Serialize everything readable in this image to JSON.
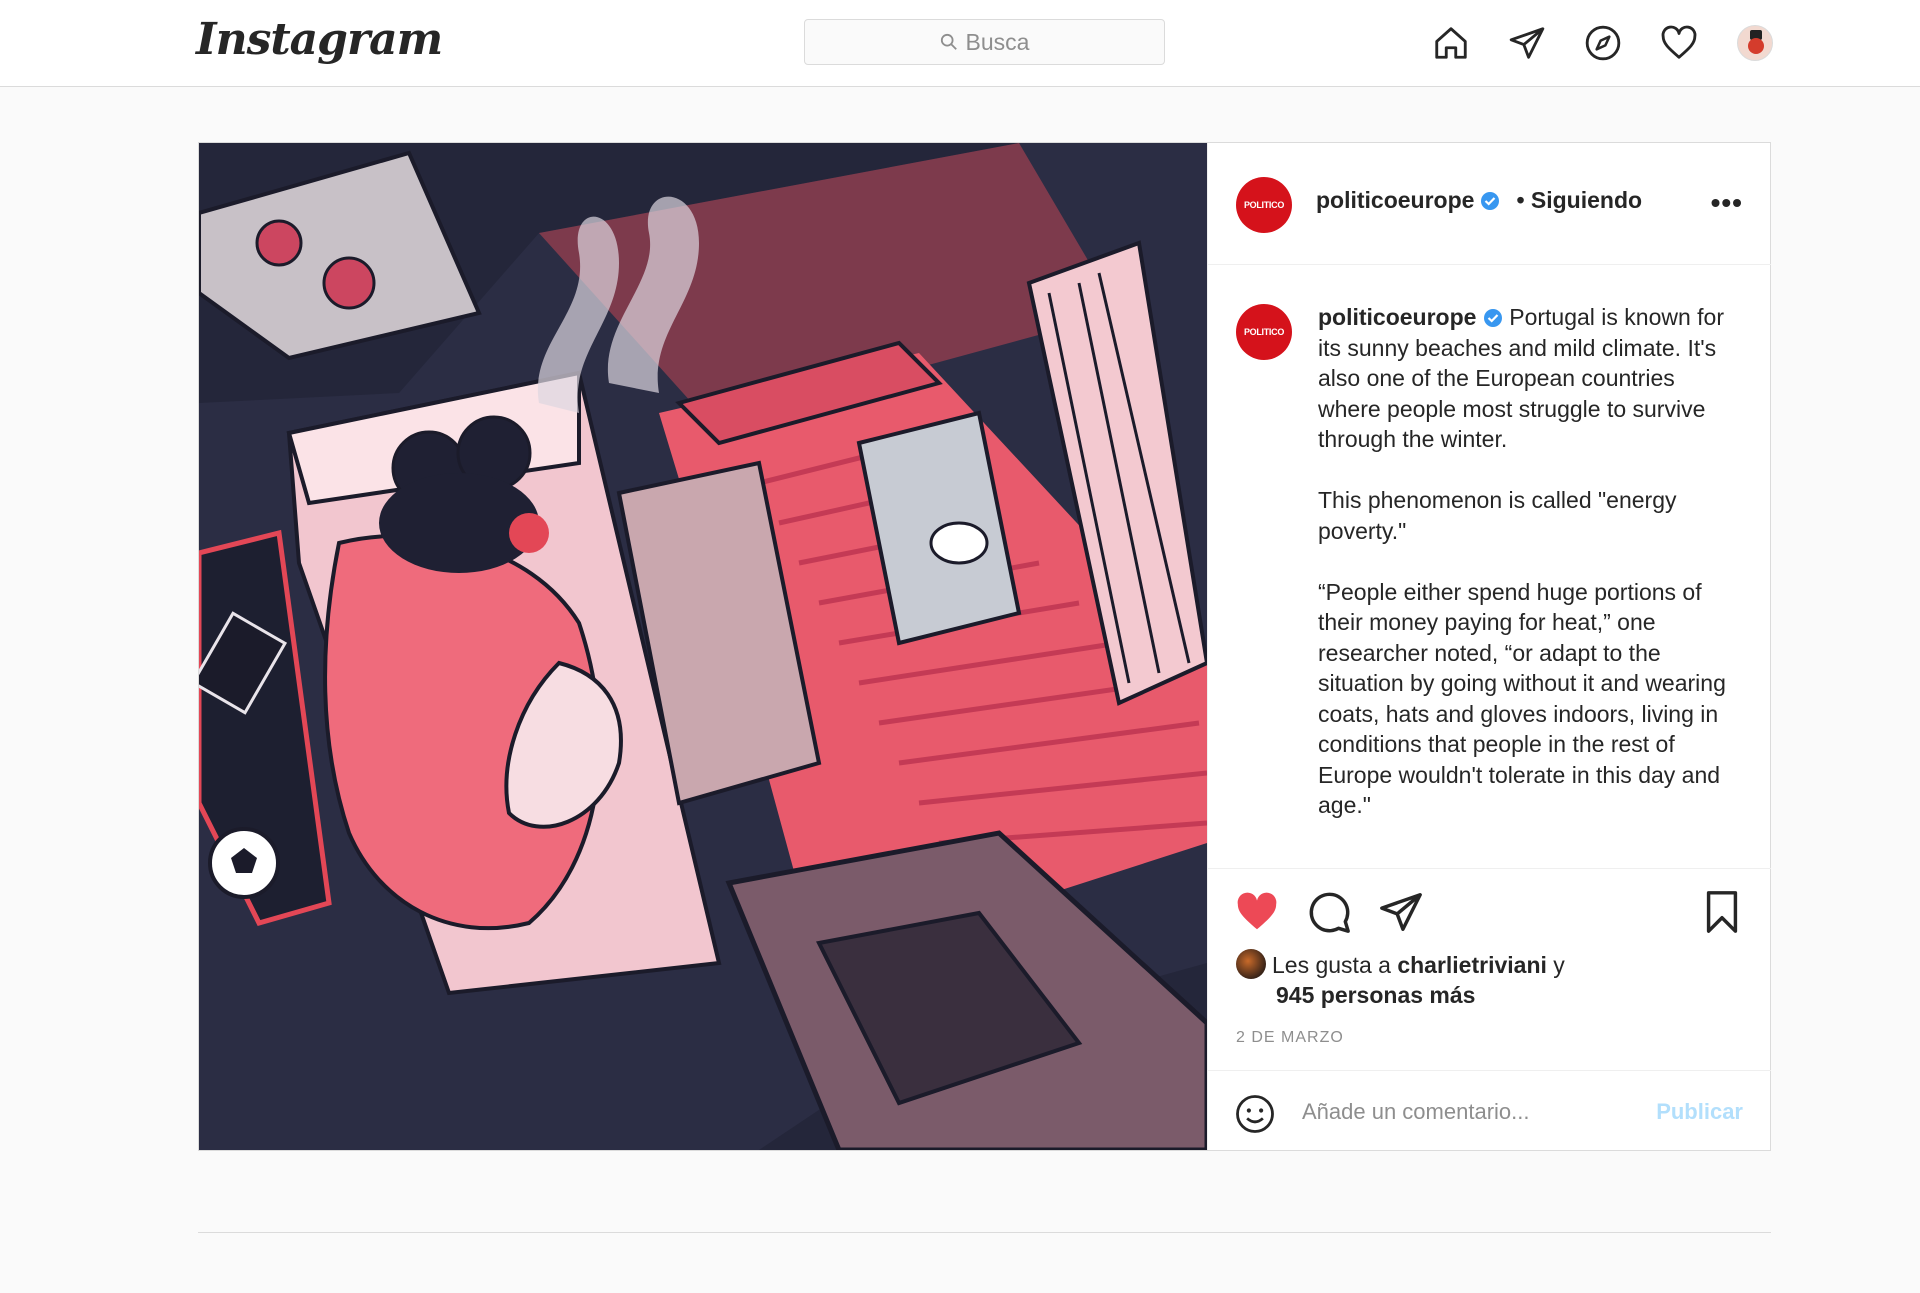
{
  "nav": {
    "logo": "Instagram",
    "search_placeholder": "Busca",
    "icons": [
      "home-icon",
      "direct-icon",
      "explore-icon",
      "activity-icon",
      "profile-avatar"
    ]
  },
  "post": {
    "author": "politicoeurope",
    "author_badge": "POLITICO",
    "following": "• Siguiendo",
    "more": "•••",
    "caption": {
      "author": "politicoeurope",
      "p1": "Portugal is known for its sunny beaches and mild climate. It's also one of the European countries where people most struggle to survive through the winter.",
      "p2": "This phenomenon is called \"energy poverty.\"",
      "p3": "“People either spend huge portions of their money paying for heat,” one researcher noted, “or adapt to the situation by going without it and wearing coats, hats and gloves indoors, living in conditions that people in the rest of Europe wouldn't tolerate in this day and age.\""
    },
    "likes": {
      "prefix": "Les gusta a",
      "user": "charlietriviani",
      "joiner": "y",
      "others": "945 personas más"
    },
    "date": "2 DE MARZO",
    "comment_placeholder": "Añade un comentario...",
    "publish_label": "Publicar",
    "liked": true
  },
  "colors": {
    "accent_red": "#ed4956",
    "verified_blue": "#3897f0",
    "publish_disabled": "#b2dffc",
    "politico_red": "#d5121b"
  }
}
